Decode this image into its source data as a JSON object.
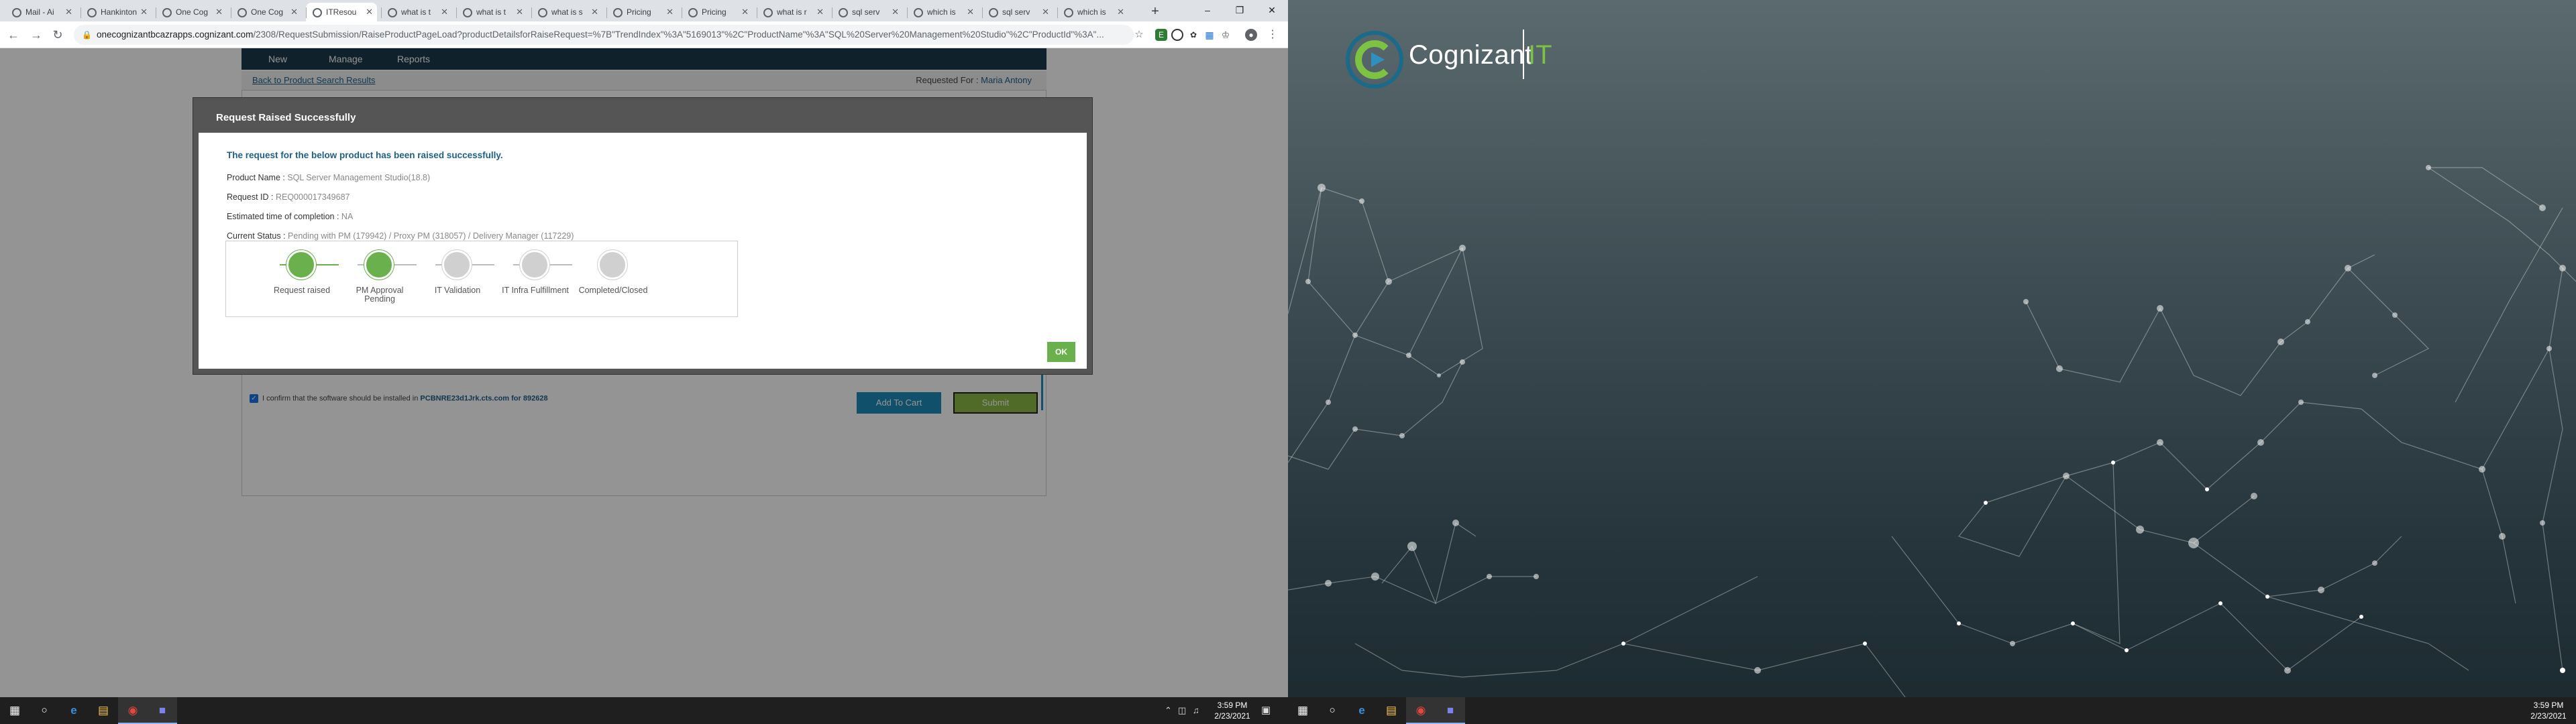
{
  "browser": {
    "tabs": [
      {
        "label": "Mail - Ai",
        "icon": "outlook-icon"
      },
      {
        "label": "Hankinton",
        "icon": "teams-icon"
      },
      {
        "label": "One Cog",
        "icon": "web-icon"
      },
      {
        "label": "One Cog",
        "icon": "web-icon"
      },
      {
        "label": "ITResou",
        "icon": "web-icon",
        "active": true
      },
      {
        "label": "what is t",
        "icon": "google-icon"
      },
      {
        "label": "what is t",
        "icon": "google-icon"
      },
      {
        "label": "what is s",
        "icon": "google-icon"
      },
      {
        "label": "Pricing",
        "icon": "web-icon"
      },
      {
        "label": "Pricing",
        "icon": "web-icon"
      },
      {
        "label": "what is r",
        "icon": "google-icon"
      },
      {
        "label": "sql serv",
        "icon": "google-icon"
      },
      {
        "label": "which is",
        "icon": "google-icon"
      },
      {
        "label": "sql serv",
        "icon": "google-icon"
      },
      {
        "label": "which is",
        "icon": "google-icon"
      }
    ],
    "url_host": "onecognizantbcazrapps.cognizant.com",
    "url_path": "/2308/RequestSubmission/RaiseProductPageLoad?productDetailsforRaiseRequest=%7B\"TrendIndex\"%3A\"5169013\"%2C\"ProductName\"%3A\"SQL%20Server%20Management%20Studio\"%2C\"ProductId\"%3A\"..."
  },
  "app": {
    "nav": [
      "New",
      "Manage",
      "Reports"
    ],
    "back_link": "Back to Product Search Results",
    "requested_for_label": "Requested For :",
    "requested_for_name": "Maria Antony",
    "confirm_text": "I confirm that the software should be installed in",
    "confirm_host": "PCBNRE23d1Jrk.cts.com for 892628",
    "add_to_cart": "Add To Cart",
    "submit": "Submit"
  },
  "modal": {
    "title": "Request Raised Successfully",
    "message": "The request for the below product has been raised successfully.",
    "fields": [
      {
        "label": "Product Name :",
        "value": "SQL Server Management Studio(18.8)"
      },
      {
        "label": "Request ID :",
        "value": "REQ000017349687"
      },
      {
        "label": "Estimated time of completion :",
        "value": "NA"
      },
      {
        "label": "Current Status :",
        "value": "Pending with PM (179942) / Proxy PM (318057) / Delivery Manager (117229)"
      }
    ],
    "steps": [
      {
        "label": "Request raised",
        "status": "done"
      },
      {
        "label": "PM Approval Pending",
        "status": "done"
      },
      {
        "label": "IT Validation",
        "status": "todo"
      },
      {
        "label": "IT Infra Fulfillment",
        "status": "todo"
      },
      {
        "label": "Completed/Closed",
        "status": "todo"
      }
    ],
    "ok_label": "OK"
  },
  "taskbar_left": {
    "time": "3:59 PM",
    "date": "2/23/2021"
  },
  "taskbar_right": {
    "time": "3:59 PM",
    "date": "2/23/2021"
  },
  "desktop": {
    "logo_word": "Cognizant",
    "logo_suffix": "IT"
  },
  "colors": {
    "accent_green": "#6ab04c",
    "nav_dark": "#1b3a4b",
    "link_blue": "#1d5f8a",
    "step_todo": "#d0d0d0"
  }
}
